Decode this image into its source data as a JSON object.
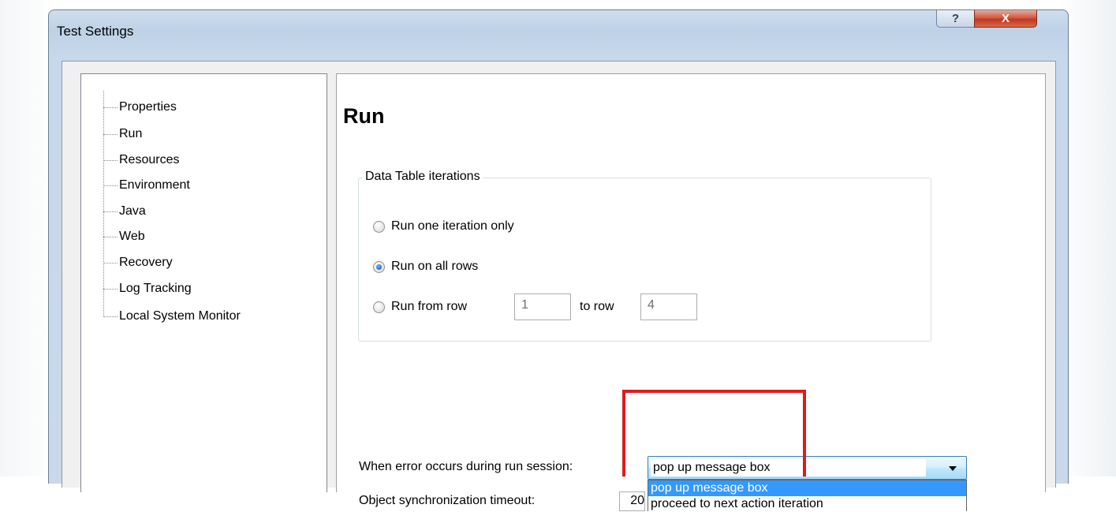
{
  "window": {
    "title": "Test Settings",
    "help_label": "?",
    "close_label": "X"
  },
  "tree": {
    "items": [
      {
        "label": "Properties"
      },
      {
        "label": "Run"
      },
      {
        "label": "Resources"
      },
      {
        "label": "Environment"
      },
      {
        "label": "Java"
      },
      {
        "label": "Web"
      },
      {
        "label": "Recovery"
      },
      {
        "label": "Log Tracking"
      },
      {
        "label": "Local System Monitor"
      }
    ]
  },
  "run": {
    "heading": "Run",
    "iterations_group": {
      "legend": "Data Table iterations",
      "options": [
        {
          "label": "Run one iteration only",
          "checked": false
        },
        {
          "label": "Run on all rows",
          "checked": true
        },
        {
          "label": "Run from row",
          "checked": false
        }
      ],
      "from_row": "1",
      "to_row_label": "to row",
      "to_row": "4"
    },
    "error_label": "When error occurs during run session:",
    "error_select": {
      "value": "pop up message box",
      "options": [
        "pop up message box",
        "proceed to next action iteration"
      ]
    },
    "sync_label": "Object synchronization timeout:",
    "sync_value": "20"
  }
}
